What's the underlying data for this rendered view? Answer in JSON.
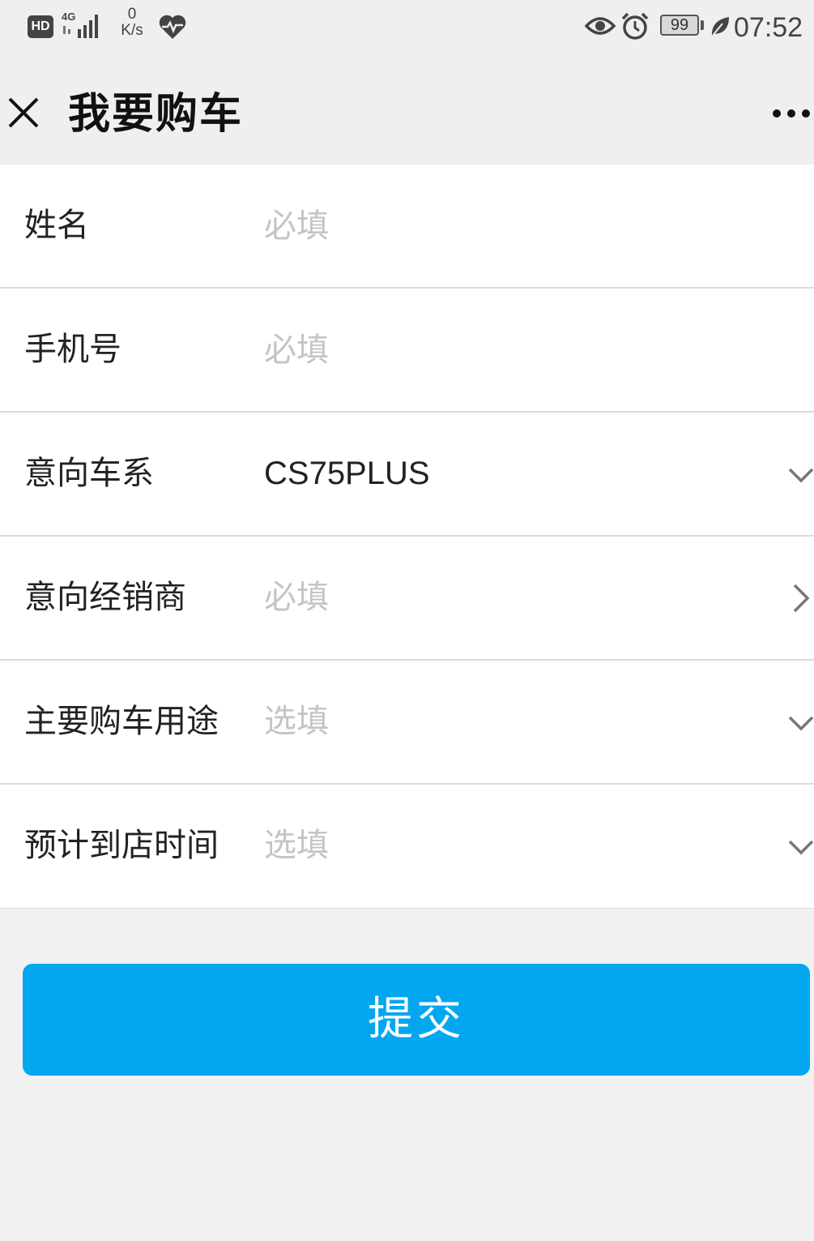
{
  "status_bar": {
    "hd_badge": "HD",
    "network": "4G",
    "speed_value": "0",
    "speed_unit": "K/s",
    "battery_level": "99",
    "time": "07:52",
    "icons": [
      "hd-icon",
      "signal-icon",
      "heart-monitor-icon",
      "eye-icon",
      "alarm-icon",
      "battery-icon",
      "leaf-icon"
    ]
  },
  "nav": {
    "title": "我要购车",
    "close_icon": "close-icon",
    "more_icon": "more-icon"
  },
  "form": {
    "rows": [
      {
        "label": "姓名",
        "placeholder": "必填",
        "value": "",
        "control": "text"
      },
      {
        "label": "手机号",
        "placeholder": "必填",
        "value": "",
        "control": "text"
      },
      {
        "label": "意向车系",
        "placeholder": "",
        "value": "CS75PLUS",
        "control": "dropdown",
        "indicator": "chevron-down-icon"
      },
      {
        "label": "意向经销商",
        "placeholder": "必填",
        "value": "",
        "control": "link",
        "indicator": "chevron-right-icon"
      },
      {
        "label": "主要购车用途",
        "placeholder": "选填",
        "value": "",
        "control": "dropdown",
        "indicator": "chevron-down-icon"
      },
      {
        "label": "预计到店时间",
        "placeholder": "选填",
        "value": "",
        "control": "dropdown",
        "indicator": "chevron-down-icon"
      }
    ]
  },
  "submit": {
    "label": "提交"
  },
  "colors": {
    "accent": "#03a7f0",
    "background": "#f1f1f1",
    "placeholder": "#c4c4c4",
    "divider": "#dcdcdc"
  }
}
